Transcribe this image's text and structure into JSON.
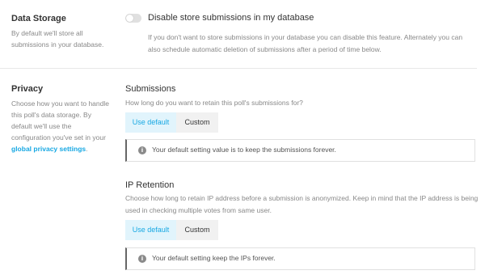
{
  "data_storage": {
    "title": "Data Storage",
    "description": "By default we'll store all submissions in your database.",
    "toggle_label": "Disable store submissions in my database",
    "toggle_on": false,
    "toggle_description": "If you don't want to store submissions in your database you can disable this feature. Alternately you can also schedule automatic deletion of submissions after a period of time below."
  },
  "privacy": {
    "title": "Privacy",
    "description_prefix": "Choose how you want to handle this poll's data storage. By default we'll use the configuration you've set in your ",
    "link_text": "global privacy settings",
    "description_suffix": "."
  },
  "submissions": {
    "title": "Submissions",
    "description": "How long do you want to retain this poll's submissions for?",
    "options": [
      "Use default",
      "Custom"
    ],
    "selected": "Use default",
    "notice": "Your default setting value is to keep the submissions forever."
  },
  "ip_retention": {
    "title": "IP Retention",
    "description": "Choose how long to retain IP address before a submission is anonymized. Keep in mind that the IP address is being used in checking multiple votes from same user.",
    "options": [
      "Use default",
      "Custom"
    ],
    "selected": "Use default",
    "notice": "Your default setting keep the IPs forever."
  },
  "colors": {
    "accent": "#17a8e3",
    "active_bg": "#e1f4fc",
    "inactive_bg": "#f1f1f1"
  },
  "icons": {
    "info": "info-icon"
  }
}
